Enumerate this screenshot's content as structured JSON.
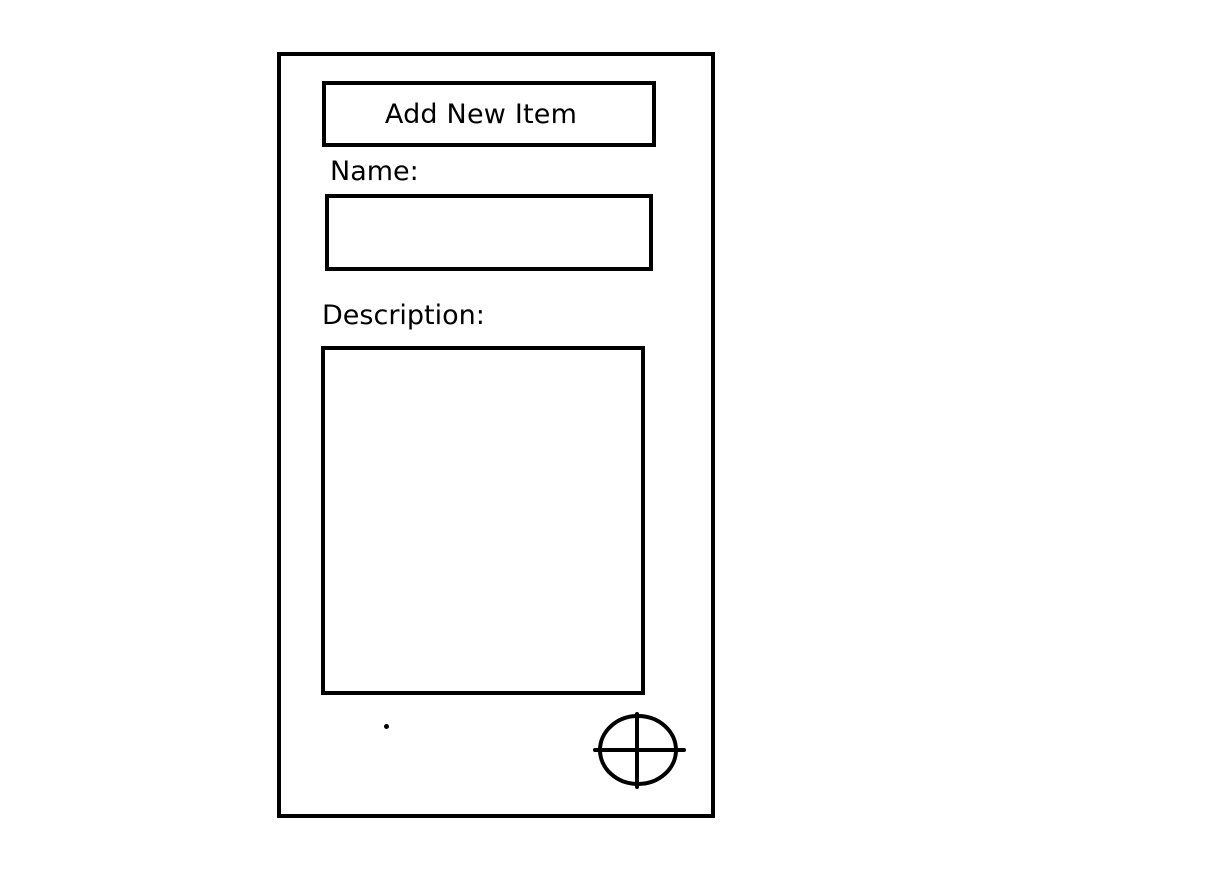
{
  "screen": {
    "title": "Add New Item"
  },
  "form": {
    "name_label": "Name:",
    "name_value": "",
    "description_label": "Description:",
    "description_value": ""
  },
  "actions": {
    "add_button_icon": "crosshair-plus-icon"
  },
  "colors": {
    "stroke": "#000000",
    "background": "#ffffff"
  }
}
